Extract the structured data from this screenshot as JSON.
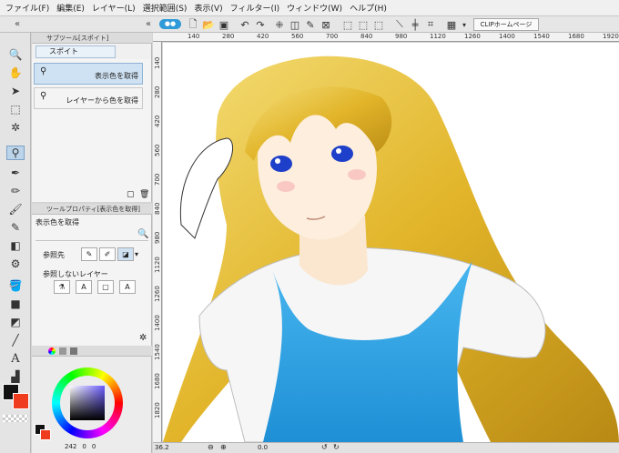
{
  "menu": [
    "ファイル(F)",
    "編集(E)",
    "レイヤー(L)",
    "選択範囲(S)",
    "表示(V)",
    "フィルター(I)",
    "ウィンドウ(W)",
    "ヘルプ(H)"
  ],
  "command_bar": {
    "clip_home": "CLIPホームページ"
  },
  "ruler": {
    "top_ticks": [
      "140",
      "280",
      "420",
      "560",
      "700",
      "840",
      "980",
      "1120",
      "1260",
      "1400",
      "1540",
      "1680",
      "1920"
    ],
    "left_ticks": [
      "140",
      "280",
      "420",
      "560",
      "700",
      "840",
      "980",
      "1120",
      "1260",
      "1400",
      "1540",
      "1680",
      "1820"
    ]
  },
  "subtool_palette": {
    "header": "サブツール[スポイト]",
    "tab": "スポイト",
    "items": [
      {
        "label": "表示色を取得"
      },
      {
        "label": "レイヤーから色を取得"
      }
    ]
  },
  "tool_property": {
    "header": "ツールプロパティ[表示色を取得]",
    "name": "表示色を取得",
    "ref_label": "参照先",
    "ref_layers_label": "参照しないレイヤー"
  },
  "color_panel": {
    "values": [
      "242",
      "0",
      "0"
    ]
  },
  "status": {
    "zoom": "36.2",
    "angle": "0.0"
  },
  "colors": {
    "accent": "#2f9ad8",
    "main_color": "#1a1a1a",
    "sub_color": "#f03c1e"
  }
}
